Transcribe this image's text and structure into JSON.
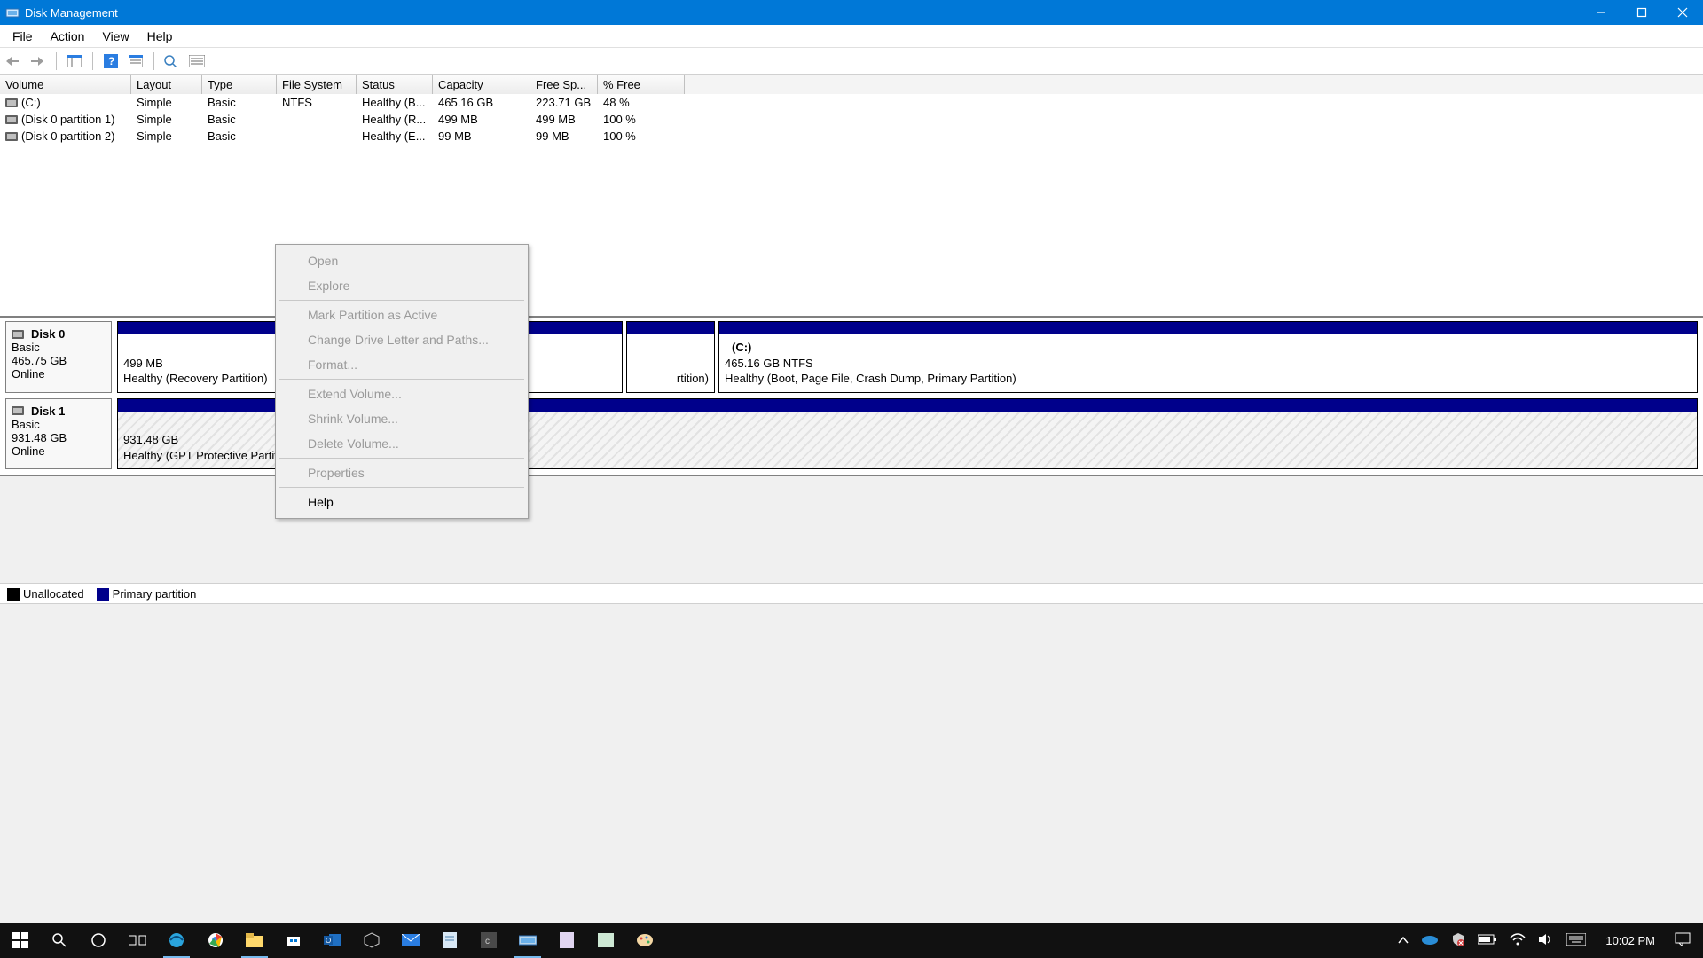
{
  "window": {
    "title": "Disk Management"
  },
  "menubar": [
    "File",
    "Action",
    "View",
    "Help"
  ],
  "columns": {
    "volume": "Volume",
    "layout": "Layout",
    "type": "Type",
    "fs": "File System",
    "status": "Status",
    "capacity": "Capacity",
    "free": "Free Sp...",
    "pctfree": "% Free"
  },
  "volumes": [
    {
      "name": "(C:)",
      "layout": "Simple",
      "type": "Basic",
      "fs": "NTFS",
      "status": "Healthy (B...",
      "capacity": "465.16 GB",
      "free": "223.71 GB",
      "pct": "48 %"
    },
    {
      "name": "(Disk 0 partition 1)",
      "layout": "Simple",
      "type": "Basic",
      "fs": "",
      "status": "Healthy (R...",
      "capacity": "499 MB",
      "free": "499 MB",
      "pct": "100 %"
    },
    {
      "name": "(Disk 0 partition 2)",
      "layout": "Simple",
      "type": "Basic",
      "fs": "",
      "status": "Healthy (E...",
      "capacity": "99 MB",
      "free": "99 MB",
      "pct": "100 %"
    }
  ],
  "disks": {
    "d0": {
      "name": "Disk 0",
      "type": "Basic",
      "size": "465.75 GB",
      "state": "Online",
      "p0": {
        "size": "499 MB",
        "status": "Healthy (Recovery Partition)"
      },
      "p1": {
        "status": "rtition)"
      },
      "p2": {
        "label": "(C:)",
        "size": "465.16 GB NTFS",
        "status": "Healthy (Boot, Page File, Crash Dump, Primary Partition)"
      }
    },
    "d1": {
      "name": "Disk 1",
      "type": "Basic",
      "size": "931.48 GB",
      "state": "Online",
      "p0": {
        "size": "931.48 GB",
        "status": "Healthy (GPT Protective Partition)"
      }
    }
  },
  "legend": {
    "unallocated": "Unallocated",
    "primary": "Primary partition"
  },
  "context_menu": {
    "open": "Open",
    "explore": "Explore",
    "mark": "Mark Partition as Active",
    "change": "Change Drive Letter and Paths...",
    "format": "Format...",
    "extend": "Extend Volume...",
    "shrink": "Shrink Volume...",
    "delete": "Delete Volume...",
    "properties": "Properties",
    "help": "Help"
  },
  "taskbar": {
    "clock": "10:02 PM"
  }
}
